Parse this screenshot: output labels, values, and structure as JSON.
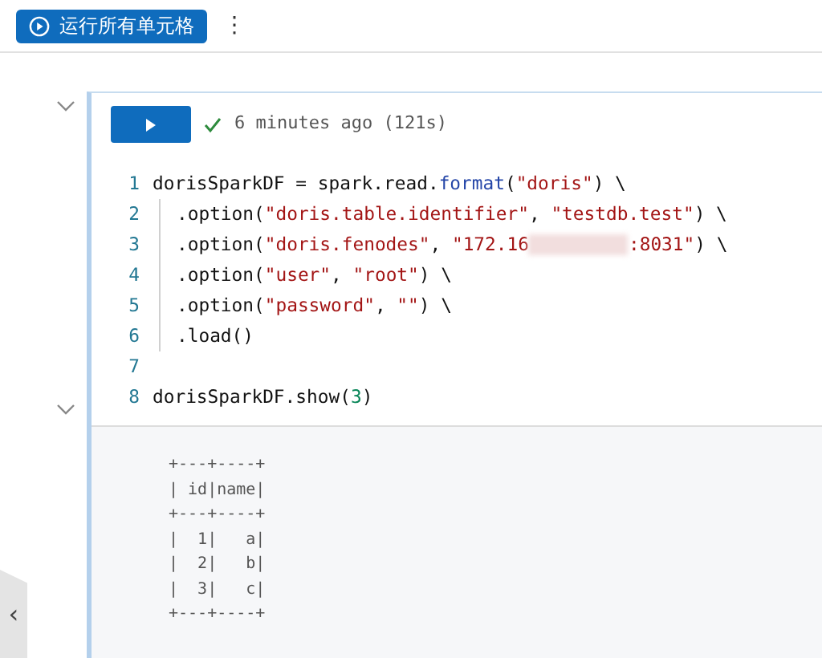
{
  "toolbar": {
    "run_all_label": "运行所有单元格",
    "more_icon": "⋮"
  },
  "cell": {
    "expanded": true,
    "status": "6 minutes ago (121s)",
    "succeeded": true,
    "lines": [
      {
        "number": "1",
        "indent": false,
        "tokens": [
          {
            "kind": "plain",
            "text": "dorisSparkDF = spark.read."
          },
          {
            "kind": "func",
            "text": "format"
          },
          {
            "kind": "plain",
            "text": "("
          },
          {
            "kind": "str",
            "text": "\"doris\""
          },
          {
            "kind": "plain",
            "text": ") \\"
          }
        ]
      },
      {
        "number": "2",
        "indent": true,
        "tokens": [
          {
            "kind": "plain",
            "text": ".option("
          },
          {
            "kind": "str",
            "text": "\"doris.table.identifier\""
          },
          {
            "kind": "plain",
            "text": ", "
          },
          {
            "kind": "str",
            "text": "\"testdb.test\""
          },
          {
            "kind": "plain",
            "text": ") \\"
          }
        ]
      },
      {
        "number": "3",
        "indent": true,
        "tokens": [
          {
            "kind": "plain",
            "text": ".option("
          },
          {
            "kind": "str",
            "text": "\"doris.fenodes\""
          },
          {
            "kind": "plain",
            "text": ", "
          },
          {
            "kind": "str",
            "text": "\"172.16"
          },
          {
            "kind": "redacted"
          },
          {
            "kind": "str",
            "text": ":8031\""
          },
          {
            "kind": "plain",
            "text": ") \\"
          }
        ]
      },
      {
        "number": "4",
        "indent": true,
        "tokens": [
          {
            "kind": "plain",
            "text": ".option("
          },
          {
            "kind": "str",
            "text": "\"user\""
          },
          {
            "kind": "plain",
            "text": ", "
          },
          {
            "kind": "str",
            "text": "\"root\""
          },
          {
            "kind": "plain",
            "text": ") \\"
          }
        ]
      },
      {
        "number": "5",
        "indent": true,
        "tokens": [
          {
            "kind": "plain",
            "text": ".option("
          },
          {
            "kind": "str",
            "text": "\"password\""
          },
          {
            "kind": "plain",
            "text": ", "
          },
          {
            "kind": "str",
            "text": "\"\""
          },
          {
            "kind": "plain",
            "text": ") \\"
          }
        ]
      },
      {
        "number": "6",
        "indent": true,
        "tokens": [
          {
            "kind": "plain",
            "text": ".load()"
          }
        ]
      },
      {
        "number": "7",
        "indent": false
      },
      {
        "number": "8",
        "indent": false,
        "tokens": [
          {
            "kind": "plain",
            "text": "dorisSparkDF.show("
          },
          {
            "kind": "num",
            "text": "3"
          },
          {
            "kind": "plain",
            "text": ")"
          }
        ]
      }
    ]
  },
  "output": {
    "expanded": true,
    "lines": [
      "+---+----+",
      "| id|name|",
      "+---+----+",
      "|  1|   a|",
      "|  2|   b|",
      "|  3|   c|",
      "+---+----+"
    ]
  },
  "side_tab": {
    "icon": "‹"
  }
}
